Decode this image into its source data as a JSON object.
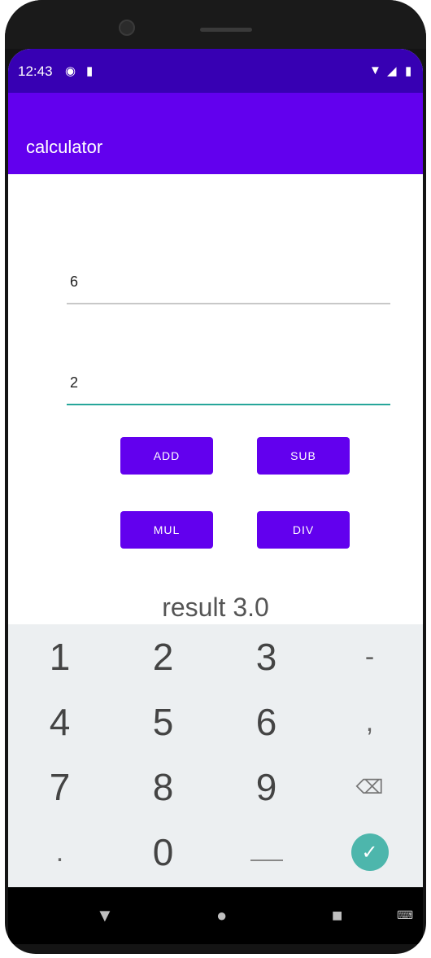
{
  "status": {
    "time": "12:43"
  },
  "app": {
    "title": "calculator"
  },
  "inputs": {
    "first_value": "6",
    "second_value": "2"
  },
  "buttons": {
    "add": "ADD",
    "sub": "SUB",
    "mul": "MUL",
    "div": "DIV"
  },
  "result": {
    "text": "result 3.0"
  },
  "keyboard": {
    "rows": [
      [
        "1",
        "2",
        "3",
        "-"
      ],
      [
        "4",
        "5",
        "6",
        ","
      ],
      [
        "7",
        "8",
        "9",
        "backspace-icon"
      ],
      [
        ".",
        "0",
        "space",
        "done-icon"
      ]
    ]
  },
  "colors": {
    "status_bar": "#3700b3",
    "app_bar": "#6200ee",
    "button": "#6200ee",
    "focus_line": "#26a69a",
    "keyboard_bg": "#eceff1",
    "done_key": "#4db6ac"
  }
}
